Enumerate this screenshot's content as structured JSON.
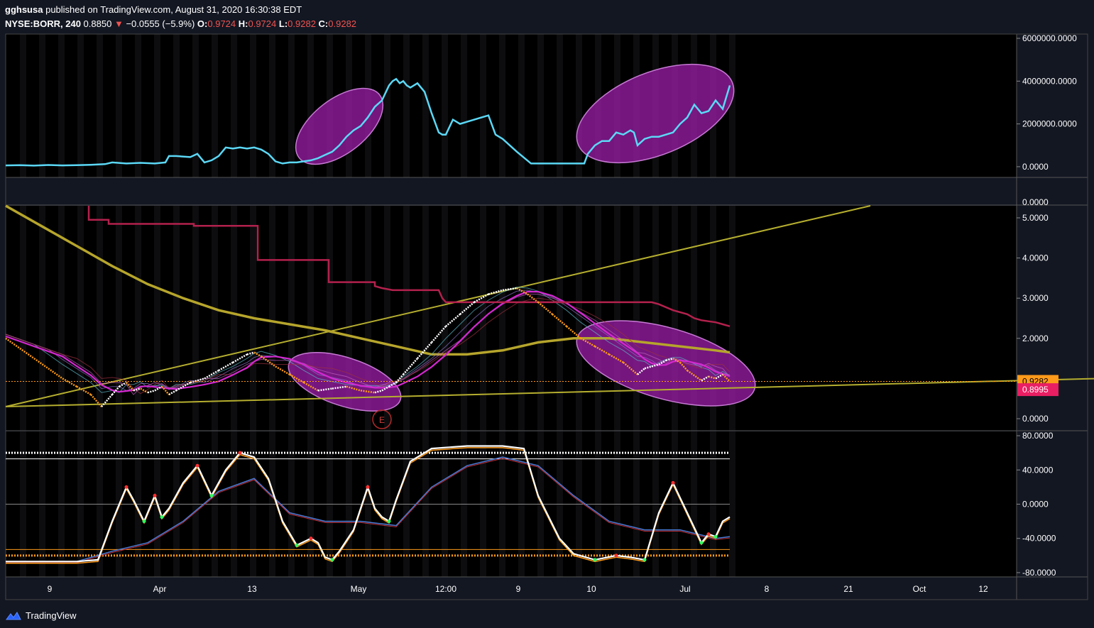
{
  "header": {
    "publisher": "gghsusa",
    "published_text": "published on TradingView.com, August 31, 2020 16:30:38 EDT",
    "symbol": "NYSE:BORR, 240",
    "last": "0.8850",
    "change_arrow": "▼",
    "change": "−0.0555 (−5.9%)",
    "o_label": "O:",
    "o": "0.9724",
    "h_label": "H:",
    "h": "0.9724",
    "l_label": "L:",
    "l": "0.9282",
    "c_label": "C:",
    "c": "0.9282"
  },
  "footer": {
    "brand": "TradingView",
    "logo_icon": "tradingview-logo-icon"
  },
  "colors": {
    "background": "#131722",
    "pane": "#000000",
    "obv_line": "#5bd8f6",
    "highlight": "#9b1ea8",
    "ma200": "#b6a52c",
    "trendline": "#b5ae2f",
    "stop_line": "#b3214d",
    "magenta": "#d428d0",
    "price_up": "#ffffff",
    "price_down": "#ff9a1a",
    "osc_fast": "#ffffff",
    "osc_slow": "#ff9a1a",
    "price_badge": "#ff9a1a",
    "stop_badge": "#e91e63"
  },
  "chart_data": [
    {
      "type": "line",
      "pane": "volume-indicator",
      "y_ticks": [
        "6000000.0000",
        "4000000.0000",
        "2000000.0000",
        "0.0000"
      ],
      "ylim": [
        -500000,
        6200000
      ],
      "x": [
        0,
        20,
        40,
        60,
        80,
        100,
        120,
        140,
        150,
        170,
        190,
        210,
        225,
        230,
        240,
        260,
        270,
        280,
        290,
        300,
        310,
        320,
        330,
        340,
        350,
        360,
        370,
        380,
        390,
        400,
        410,
        420,
        430,
        440,
        450,
        460,
        470,
        480,
        490,
        500,
        510,
        520,
        530,
        540,
        545,
        550,
        555,
        560,
        565,
        570,
        580,
        590,
        600,
        610,
        615,
        620,
        630,
        640,
        650,
        660,
        670,
        680,
        690,
        700,
        720,
        740,
        760,
        780,
        790,
        800,
        810,
        815,
        820,
        830,
        840,
        850,
        860,
        870,
        880,
        885,
        890,
        900,
        910,
        920,
        930,
        940,
        950,
        960,
        970,
        980,
        990,
        1000,
        1010,
        1020
      ],
      "values": [
        60000,
        70000,
        50000,
        80000,
        60000,
        70000,
        90000,
        120000,
        200000,
        150000,
        180000,
        150000,
        200000,
        500000,
        500000,
        450000,
        600000,
        200000,
        300000,
        500000,
        900000,
        850000,
        900000,
        850000,
        900000,
        800000,
        600000,
        250000,
        150000,
        200000,
        200000,
        250000,
        300000,
        400000,
        550000,
        700000,
        1000000,
        1400000,
        1700000,
        1900000,
        2300000,
        2800000,
        3100000,
        3800000,
        4000000,
        4100000,
        3900000,
        4000000,
        3800000,
        3700000,
        3900000,
        3500000,
        2500000,
        1600000,
        1500000,
        1500000,
        2200000,
        2000000,
        2100000,
        2200000,
        2300000,
        2400000,
        1500000,
        1300000,
        700000,
        150000,
        150000,
        150000,
        150000,
        150000,
        150000,
        150000,
        600000,
        1000000,
        1200000,
        1200000,
        1600000,
        1500000,
        1700000,
        1600000,
        1000000,
        1300000,
        1400000,
        1400000,
        1500000,
        1600000,
        2000000,
        2300000,
        2900000,
        2500000,
        2600000,
        3100000,
        2700000,
        3800000
      ],
      "highlight_ranges": [
        [
          410,
          530
        ],
        [
          810,
          1020
        ]
      ]
    },
    {
      "type": "line",
      "pane": "price",
      "y_ticks": [
        "5.0000",
        "4.0000",
        "3.0000",
        "2.0000",
        "0.0000"
      ],
      "extra_tick": "0.0000",
      "ylim": [
        -0.3,
        5.3
      ],
      "price_label": "0.9282",
      "stop_label": "0.8995",
      "price_x": [
        0,
        20,
        40,
        60,
        80,
        100,
        120,
        135,
        150,
        160,
        170,
        180,
        190,
        200,
        210,
        220,
        230,
        240,
        260,
        280,
        300,
        320,
        340,
        350,
        360,
        380,
        400,
        420,
        440,
        460,
        480,
        500,
        520,
        530,
        540,
        550,
        560,
        580,
        600,
        620,
        640,
        660,
        680,
        700,
        720,
        735,
        750,
        770,
        790,
        810,
        830,
        850,
        870,
        890,
        900,
        910,
        920,
        930,
        940,
        950,
        960,
        980,
        990,
        1000,
        1010,
        1020
      ],
      "price_values": [
        2.0,
        1.75,
        1.5,
        1.25,
        1.0,
        0.8,
        0.6,
        0.3,
        0.6,
        0.8,
        0.9,
        0.7,
        0.75,
        0.65,
        0.7,
        0.8,
        0.6,
        0.7,
        0.9,
        1.0,
        1.2,
        1.4,
        1.6,
        1.65,
        1.55,
        1.3,
        1.1,
        0.9,
        0.7,
        0.75,
        0.8,
        0.7,
        0.65,
        0.7,
        0.8,
        0.9,
        1.1,
        1.5,
        1.9,
        2.3,
        2.6,
        2.9,
        3.1,
        3.2,
        3.25,
        3.1,
        2.9,
        2.6,
        2.3,
        2.0,
        1.8,
        1.6,
        1.4,
        1.1,
        1.25,
        1.3,
        1.35,
        1.45,
        1.5,
        1.4,
        1.2,
        0.95,
        1.05,
        1.0,
        1.1,
        0.93
      ],
      "stop_x": [
        117,
        117,
        145,
        145,
        265,
        265,
        355,
        355,
        455,
        455,
        520,
        520,
        530,
        545,
        610,
        615,
        620,
        910,
        920,
        940,
        960,
        970,
        980,
        1000,
        1010,
        1020
      ],
      "stop_values": [
        5.3,
        4.95,
        4.95,
        4.85,
        4.85,
        4.8,
        4.8,
        3.95,
        3.95,
        3.4,
        3.4,
        3.3,
        3.25,
        3.2,
        3.2,
        3.0,
        2.9,
        2.9,
        2.85,
        2.7,
        2.6,
        2.5,
        2.45,
        2.4,
        2.35,
        2.3
      ],
      "ma_x": [
        0,
        50,
        100,
        150,
        200,
        250,
        300,
        350,
        400,
        450,
        500,
        550,
        600,
        650,
        700,
        750,
        800,
        850,
        900,
        950,
        1000,
        1020
      ],
      "ma_values": [
        5.3,
        4.8,
        4.3,
        3.8,
        3.35,
        3.0,
        2.7,
        2.5,
        2.35,
        2.2,
        2.0,
        1.8,
        1.6,
        1.6,
        1.7,
        1.9,
        2.0,
        2.0,
        1.9,
        1.8,
        1.7,
        1.65
      ],
      "trendline_upper": [
        [
          0,
          0.3
        ],
        [
          1218,
          5.3
        ]
      ],
      "trendline_lower": [
        [
          0,
          0.3
        ],
        [
          1541,
          1.0
        ]
      ],
      "highlight_ranges": [
        [
          405,
          550
        ],
        [
          810,
          1050
        ]
      ],
      "earnings_marker": "E",
      "earnings_x": 530
    },
    {
      "type": "line",
      "pane": "oscillator",
      "y_ticks": [
        "80.0000",
        "40.0000",
        "0.0000",
        "-40.0000",
        "-80.0000"
      ],
      "ylim": [
        -85,
        85
      ],
      "levels": [
        60,
        53,
        0,
        -53,
        -60
      ],
      "fast_x": [
        0,
        60,
        100,
        130,
        150,
        170,
        180,
        195,
        210,
        220,
        230,
        250,
        270,
        290,
        310,
        330,
        350,
        370,
        390,
        410,
        430,
        440,
        450,
        460,
        470,
        490,
        510,
        520,
        530,
        540,
        550,
        570,
        600,
        650,
        700,
        730,
        750,
        780,
        800,
        830,
        860,
        880,
        900,
        920,
        940,
        960,
        980,
        990,
        1000,
        1010,
        1020
      ],
      "fast_values": [
        -67,
        -67,
        -67,
        -65,
        -20,
        20,
        5,
        -20,
        10,
        -15,
        -5,
        25,
        45,
        10,
        40,
        60,
        55,
        30,
        -20,
        -48,
        -40,
        -45,
        -62,
        -65,
        -55,
        -30,
        20,
        -5,
        -15,
        -20,
        5,
        50,
        65,
        68,
        68,
        65,
        10,
        -40,
        -58,
        -65,
        -60,
        -62,
        -65,
        -10,
        25,
        -10,
        -45,
        -35,
        -38,
        -20,
        -15
      ],
      "slow_x": [
        0,
        100,
        150,
        200,
        250,
        300,
        350,
        400,
        450,
        500,
        550,
        600,
        650,
        700,
        750,
        800,
        850,
        900,
        950,
        1000,
        1020
      ],
      "slow_values": [
        -67,
        -67,
        -55,
        -45,
        -20,
        15,
        30,
        -10,
        -20,
        -20,
        -25,
        20,
        45,
        55,
        45,
        10,
        -20,
        -30,
        -30,
        -40,
        -38
      ]
    }
  ],
  "x_axis_ticks": [
    "9",
    "Apr",
    "13",
    "May",
    "12:00",
    "9",
    "10",
    "Jul",
    "8",
    "21",
    "Oct",
    "12"
  ]
}
